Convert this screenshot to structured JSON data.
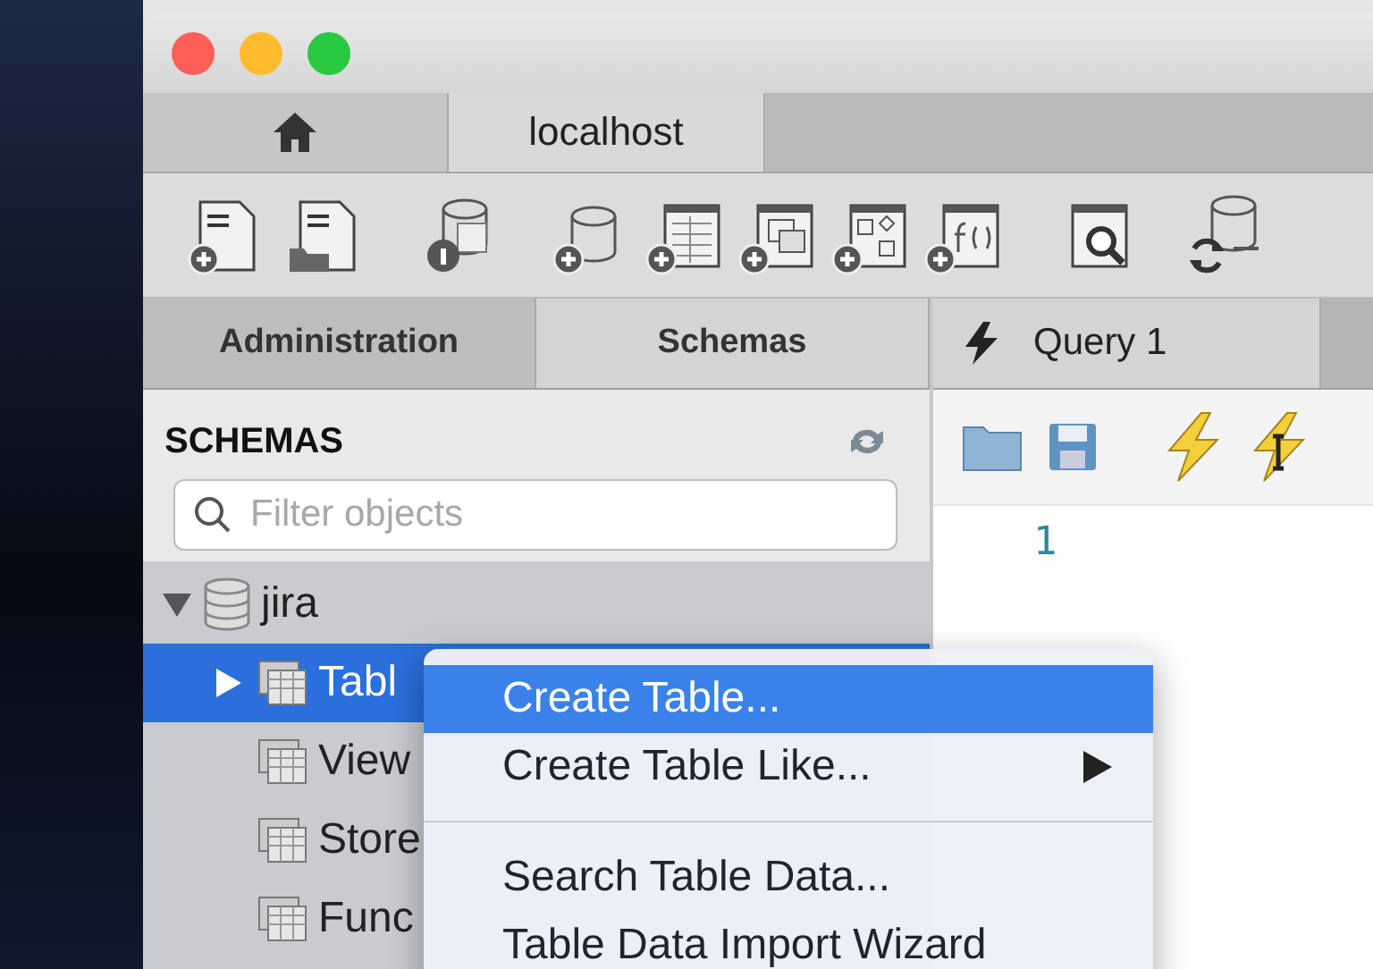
{
  "window_tabs": [
    {
      "kind": "home",
      "selected": false
    },
    {
      "kind": "text",
      "label": "localhost",
      "selected": true
    }
  ],
  "sidebar_tabs": [
    {
      "label": "Administration",
      "selected": false
    },
    {
      "label": "Schemas",
      "selected": true
    }
  ],
  "query_tab": {
    "label": "Query 1"
  },
  "schemas": {
    "title": "SCHEMAS",
    "search": {
      "placeholder": "Filter objects"
    },
    "tree": [
      {
        "label": "jira",
        "expanded": true,
        "children": [
          {
            "label": "Tabl",
            "selected": true
          },
          {
            "label": "View",
            "selected": false
          },
          {
            "label": "Store",
            "selected": false
          },
          {
            "label": "Func",
            "selected": false
          }
        ]
      }
    ]
  },
  "editor": {
    "line_numbers": [
      "1"
    ]
  },
  "context_menu": [
    {
      "kind": "item",
      "label": "Create Table...",
      "selected": true,
      "submenu": false
    },
    {
      "kind": "item",
      "label": "Create Table Like...",
      "selected": false,
      "submenu": true
    },
    {
      "kind": "separator"
    },
    {
      "kind": "item",
      "label": "Search Table Data...",
      "selected": false,
      "submenu": false
    },
    {
      "kind": "item",
      "label": "Table Data Import Wizard",
      "selected": false,
      "submenu": false
    }
  ]
}
